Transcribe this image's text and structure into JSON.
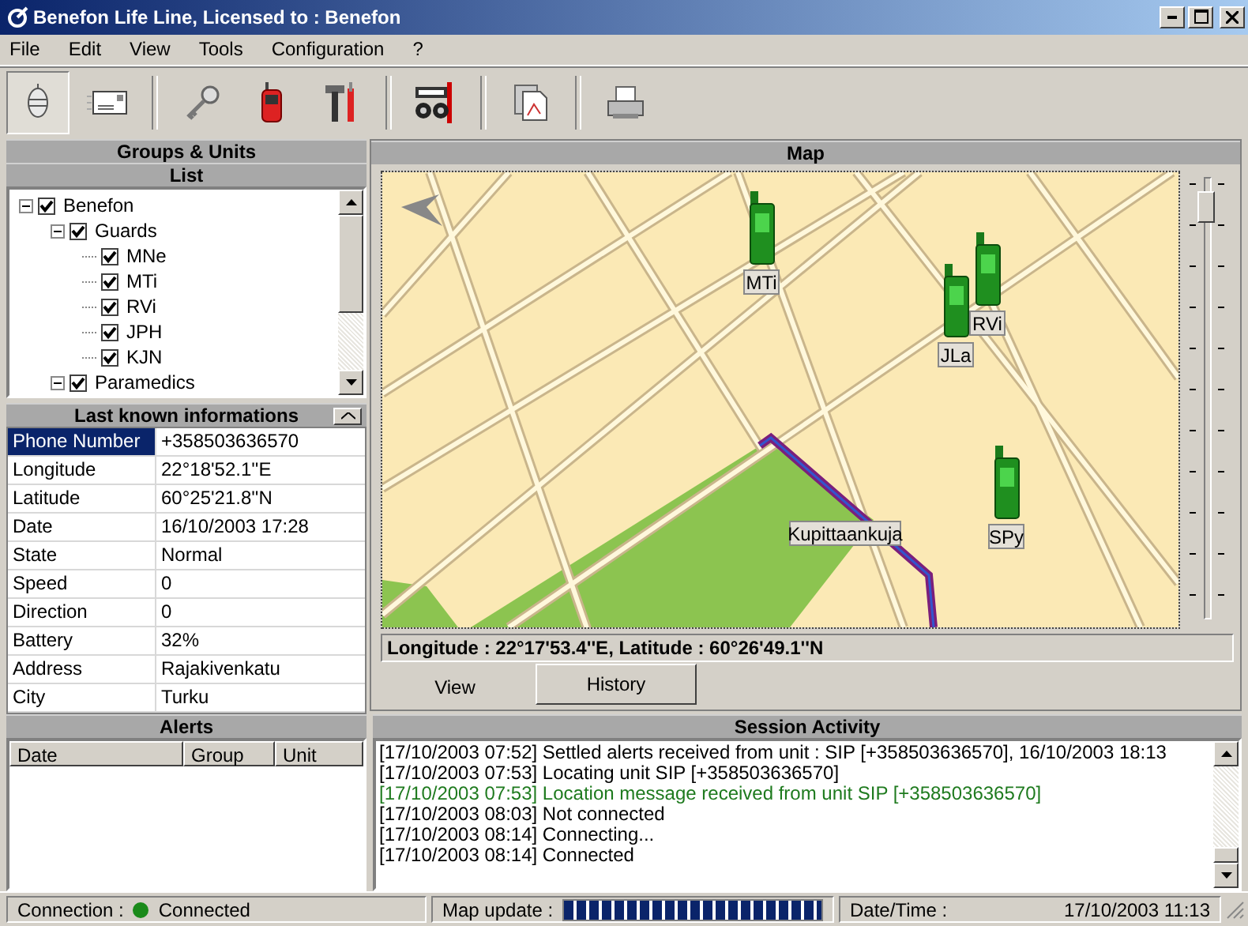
{
  "window": {
    "title": "Benefon Life Line, Licensed to : Benefon"
  },
  "menu": [
    "File",
    "Edit",
    "View",
    "Tools",
    "Configuration",
    "?"
  ],
  "toolbar": [
    {
      "kind": "lantern",
      "selected": true
    },
    {
      "kind": "envelope",
      "selected": false
    },
    {
      "kind": "separator"
    },
    {
      "kind": "key",
      "selected": false
    },
    {
      "kind": "phone",
      "selected": false
    },
    {
      "kind": "tools",
      "selected": false
    },
    {
      "kind": "separator"
    },
    {
      "kind": "binoculars",
      "selected": false
    },
    {
      "kind": "separator"
    },
    {
      "kind": "document",
      "selected": false
    },
    {
      "kind": "separator"
    },
    {
      "kind": "printer",
      "selected": false
    }
  ],
  "groups_panel": {
    "title": "Groups & Units",
    "subtitle": "List",
    "tree": [
      {
        "label": "Benefon",
        "checked": true,
        "expanded": true,
        "children": [
          {
            "label": "Guards",
            "checked": true,
            "expanded": true,
            "children": [
              {
                "label": "MNe",
                "checked": true
              },
              {
                "label": "MTi",
                "checked": true
              },
              {
                "label": "RVi",
                "checked": true
              },
              {
                "label": "JPH",
                "checked": true
              },
              {
                "label": "KJN",
                "checked": true
              }
            ]
          },
          {
            "label": "Paramedics",
            "checked": true,
            "expanded": true
          }
        ]
      }
    ]
  },
  "info_panel": {
    "title": "Last known informations",
    "rows": [
      {
        "label": "Phone Number",
        "value": "+358503636570",
        "selected": true
      },
      {
        "label": "Longitude",
        "value": "22°18'52.1''E",
        "selected": false
      },
      {
        "label": "Latitude",
        "value": "60°25'21.8''N",
        "selected": false
      },
      {
        "label": "Date",
        "value": "16/10/2003 17:28",
        "selected": false
      },
      {
        "label": "State",
        "value": "Normal",
        "selected": false
      },
      {
        "label": "Speed",
        "value": "0",
        "selected": false
      },
      {
        "label": "Direction",
        "value": "0",
        "selected": false
      },
      {
        "label": "Battery",
        "value": "32%",
        "selected": false
      },
      {
        "label": "Address",
        "value": "Rajakivenkatu",
        "selected": false
      },
      {
        "label": "City",
        "value": "Turku",
        "selected": false
      }
    ]
  },
  "map_panel": {
    "title": "Map",
    "units": [
      {
        "label": "MTi"
      },
      {
        "label": "JLa"
      },
      {
        "label": "RVi"
      },
      {
        "label": "SPy"
      }
    ],
    "street_label": "Kupittaankuja",
    "zoom": {
      "level": 0.95
    },
    "coordinates": "Longitude : 22°17'53.4''E, Latitude : 60°26'49.1''N",
    "tabs": [
      {
        "label": "View",
        "selected": true
      },
      {
        "label": "History",
        "selected": false
      }
    ]
  },
  "alerts_panel": {
    "title": "Alerts",
    "columns": [
      "Date",
      "Group",
      "Unit"
    ]
  },
  "session_panel": {
    "title": "Session Activity",
    "entries": [
      {
        "text": "[17/10/2003 07:52] Settled alerts received from unit : SIP [+358503636570], 16/10/2003 18:13",
        "color": "#000000"
      },
      {
        "text": "[17/10/2003 07:53] Locating unit SIP [+358503636570]",
        "color": "#000000"
      },
      {
        "text": "[17/10/2003 07:53] Location message received from unit SIP [+358503636570]",
        "color": "#1e7a1e"
      },
      {
        "text": "[17/10/2003 08:03] Not connected",
        "color": "#000000"
      },
      {
        "text": "[17/10/2003 08:14] Connecting...",
        "color": "#000000"
      },
      {
        "text": "[17/10/2003 08:14] Connected",
        "color": "#000000"
      }
    ]
  },
  "status_bar": {
    "connection_label": "Connection :",
    "connection_state": "Connected",
    "connected": true,
    "map_update_label": "Map update :",
    "map_update": {
      "level": 1
    },
    "datetime_label": "Date/Time :",
    "datetime": "17/10/2003 11:13"
  }
}
